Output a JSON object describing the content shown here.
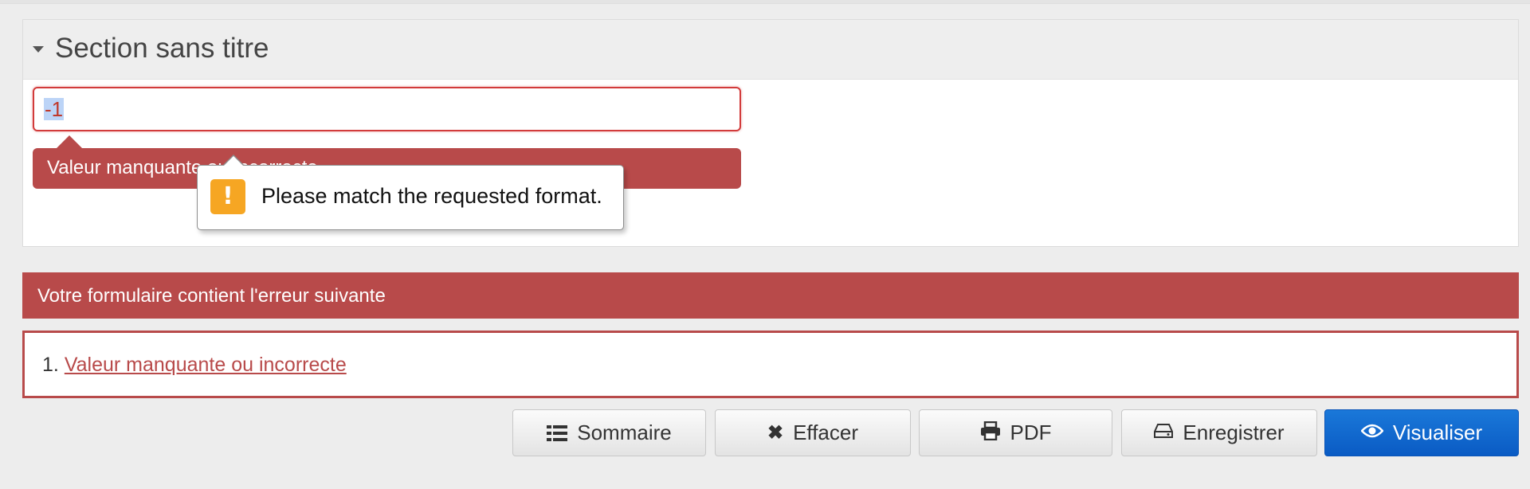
{
  "section": {
    "title": "Section sans titre"
  },
  "field": {
    "value": "-1",
    "error_message": "Valeur manquante ou incorrecte"
  },
  "tooltip": {
    "icon": "!",
    "message": "Please match the requested format."
  },
  "alert": {
    "title": "Votre formulaire contient l'erreur suivante",
    "items": [
      {
        "number": "1.",
        "label": "Valeur manquante ou incorrecte"
      }
    ]
  },
  "toolbar": {
    "summary_label": "Sommaire",
    "clear_label": "Effacer",
    "pdf_label": "PDF",
    "save_label": "Enregistrer",
    "preview_label": "Visualiser"
  },
  "colors": {
    "error": "#b84a4a",
    "primary": "#0a5bc4",
    "warning": "#f6a623"
  }
}
